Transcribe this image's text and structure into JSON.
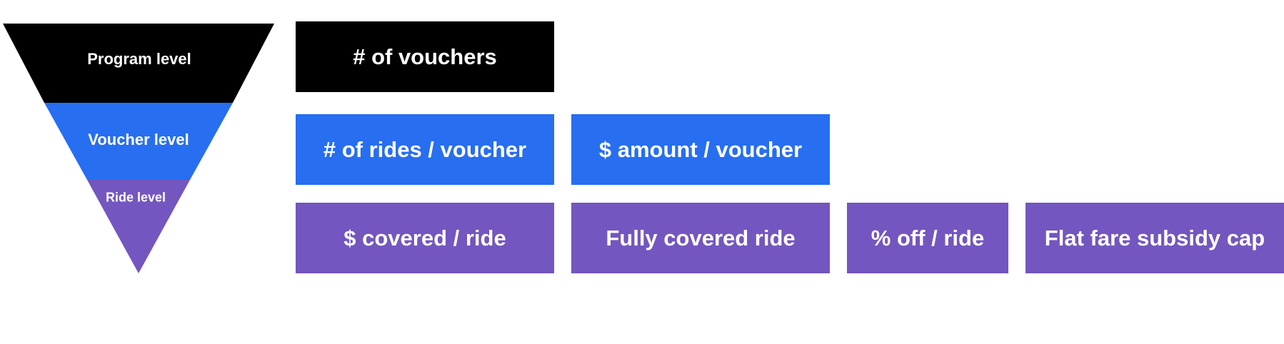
{
  "colors": {
    "program": "#000000",
    "voucher": "#276ef1",
    "ride": "#7356bf"
  },
  "funnel": {
    "program_label": "Program level",
    "voucher_label": "Voucher level",
    "ride_label": "Ride level"
  },
  "program_boxes": [
    "# of vouchers"
  ],
  "voucher_boxes": [
    "# of rides / voucher",
    "$ amount / voucher"
  ],
  "ride_boxes": [
    "$ covered / ride",
    "Fully covered ride",
    "% off / ride",
    "Flat fare subsidy cap"
  ]
}
